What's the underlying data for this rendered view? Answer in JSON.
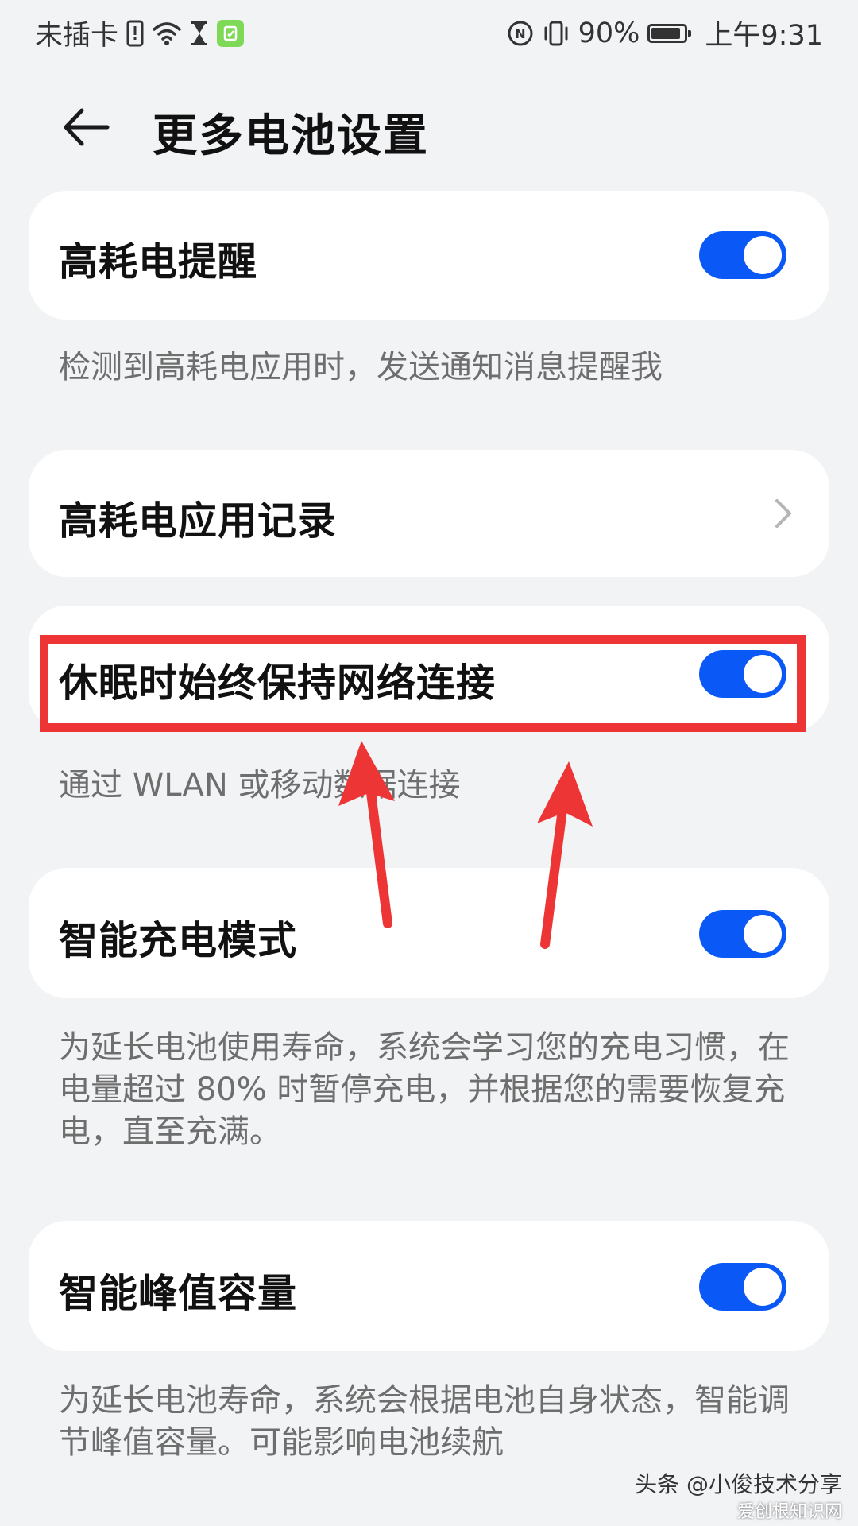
{
  "status_bar": {
    "carrier": "未插卡",
    "battery_percent": "90%",
    "time": "上午9:31",
    "icons": [
      "sim-alert-icon",
      "wifi-icon",
      "hourglass-icon",
      "note-icon",
      "nfc-icon",
      "vibrate-icon",
      "battery-icon"
    ]
  },
  "header": {
    "back_icon": "back-arrow-icon",
    "title": "更多电池设置"
  },
  "settings": [
    {
      "label": "高耗电提醒",
      "type": "toggle",
      "on": true,
      "description": "检测到高耗电应用时，发送通知消息提醒我"
    },
    {
      "label": "高耗电应用记录",
      "type": "link",
      "icon": "chevron-right-icon"
    },
    {
      "label": "休眠时始终保持网络连接",
      "type": "toggle",
      "on": true,
      "description": "通过 WLAN 或移动数据连接"
    },
    {
      "label": "智能充电模式",
      "type": "toggle",
      "on": true,
      "description": "为延长电池使用寿命，系统会学习您的充电习惯，在电量超过 80% 时暂停充电，并根据您的需要恢复充电，直至充满。"
    },
    {
      "label": "智能峰值容量",
      "type": "toggle",
      "on": true,
      "description": "为延长电池寿命，系统会根据电池自身状态，智能调节峰值容量。可能影响电池续航"
    }
  ],
  "annotation": {
    "color": "#ee3535"
  },
  "watermark": {
    "text": "头条 @小俊技术分享",
    "sub": "爱创根知识网"
  },
  "colors": {
    "accent": "#0a59f7",
    "background": "#f1f3f5",
    "card": "#ffffff"
  }
}
